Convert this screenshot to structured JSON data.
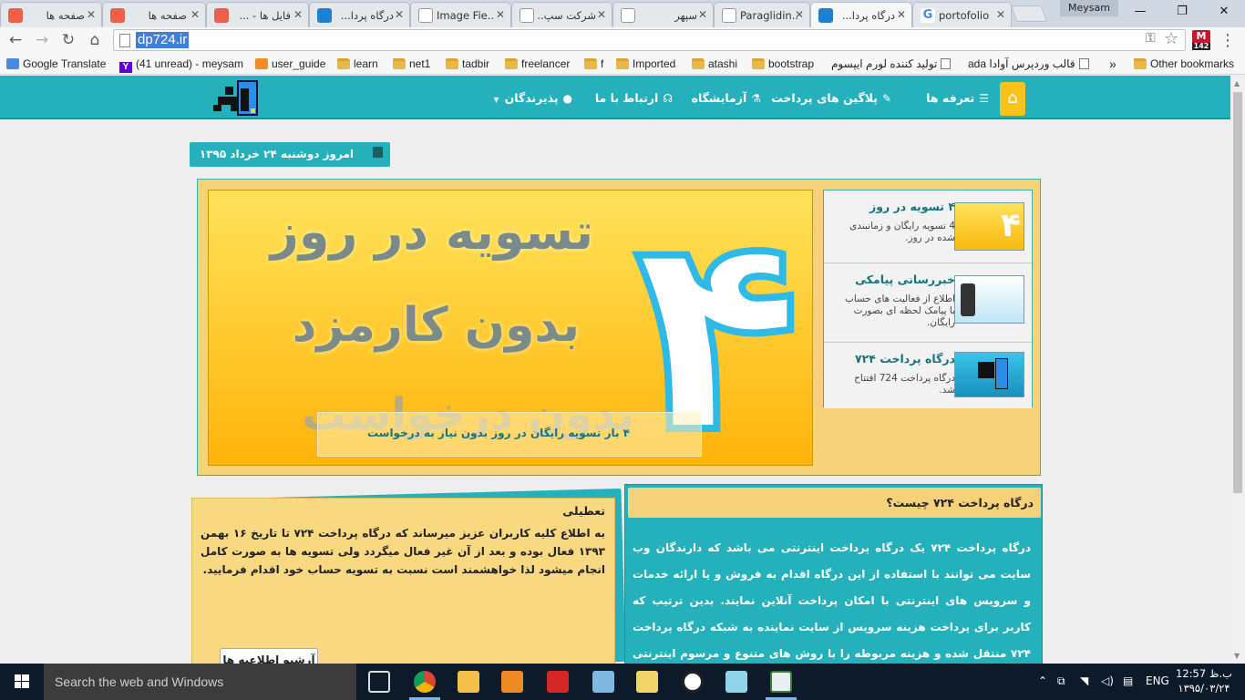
{
  "browser": {
    "tabs": [
      {
        "title": "صفحه ها",
        "favicon_color": "#e9614b"
      },
      {
        "title": "صفحه ها",
        "favicon_color": "#e9614b"
      },
      {
        "title": "فایل ها - ...",
        "favicon_color": "#e9614b"
      },
      {
        "title": "درگاه پردا...",
        "favicon_color": "#1e80d0"
      },
      {
        "title": "Image Fie...",
        "favicon_color": "#ffffff"
      },
      {
        "title": "شرکت سپ...",
        "favicon_color": "#ffffff"
      },
      {
        "title": "سپهر",
        "favicon_color": "#ffffff"
      },
      {
        "title": "Paraglidin...",
        "favicon_color": "#ffffff"
      },
      {
        "title": "درگاه پردا...",
        "favicon_color": "#1e80d0"
      },
      {
        "title": "portofolio",
        "favicon_color": "#4285f4"
      }
    ],
    "profile_name": "Meysam",
    "url": "dp724.ir",
    "extension_badge_top": "M",
    "extension_badge_bottom": "142",
    "bookmarks": [
      {
        "label": "Google Translate",
        "icon": "translate-icon"
      },
      {
        "label": "(41 unread) - meysam",
        "icon": "yahoo-icon"
      },
      {
        "label": "user_guide",
        "icon": "orange-grid-icon"
      },
      {
        "label": "learn",
        "icon": "folder-icon"
      },
      {
        "label": "net1",
        "icon": "folder-icon"
      },
      {
        "label": "tadbir",
        "icon": "folder-icon"
      },
      {
        "label": "freelancer",
        "icon": "folder-icon"
      },
      {
        "label": "f",
        "icon": "folder-icon"
      },
      {
        "label": "Imported",
        "icon": "folder-icon"
      },
      {
        "label": "atashi",
        "icon": "folder-icon"
      },
      {
        "label": "bootstrap",
        "icon": "folder-icon"
      },
      {
        "label": "تولید کننده لورم ایپسوم",
        "icon": "page-icon"
      },
      {
        "label": "قالب وردپرس آوادا ada",
        "icon": "page-icon"
      }
    ],
    "bookmarks_overflow": "»",
    "other_bookmarks": "Other bookmarks"
  },
  "site": {
    "colors": {
      "teal": "#25b1bc",
      "yellow": "#f9c31c",
      "cream": "#f5d27a"
    },
    "menu": [
      {
        "label": "تعرفه ها",
        "icon": "list-icon"
      },
      {
        "label": "پلاگین های پرداخت",
        "icon": "wrench-icon"
      },
      {
        "label": "آزمایشگاه",
        "icon": "flask-icon"
      },
      {
        "label": "ارتباط با ما",
        "icon": "headphones-icon"
      },
      {
        "label": "پذیرندگان",
        "icon": "user-icon"
      }
    ],
    "date_text": "امروز دوشنبه ۲۴ خرداد ۱۳۹۵",
    "banner": {
      "line1": "تسویه در روز",
      "line2": "بدون کارمزد",
      "line3": "بدون درخواست",
      "big_number": "۴",
      "caption": "۴ بار تسویه رایگان در روز بدون نیاز به درخواست"
    },
    "side_items": [
      {
        "title": "۴ تسویه در روز",
        "desc": "4 تسویه رایگان و زمانبندی شده در روز."
      },
      {
        "title": "خبررسانی پیامکی",
        "desc": "اطلاع از فعالیت های حساب با پیامک لحظه ای بصورت رایگان."
      },
      {
        "title": "درگاه پرداخت ۷۲۴",
        "desc": "درگاه پرداخت 724 افتتاح شد."
      }
    ],
    "notice": {
      "title": "تعطیلی",
      "body": "به اطلاع کلیه کاربران عزیز میرساند که درگاه پرداخت ۷۲۴ تا تاریخ ۱۶ بهمن ۱۳۹۳ فعال بوده و بعد از آن غیر فعال میگردد ولی تسویه ها به صورت کامل انجام میشود لذا خواهشمند است نسبت به تسویه حساب خود اقدام فرمایید.",
      "archive_button": "آرشیو اطلاعیه ها"
    },
    "what_is": {
      "title": "درگاه پرداخت ۷۲۴ چیست؟",
      "body": "درگاه پرداخت ۷۲۴ یک درگاه پرداخت اینترنتی می باشد که دارندگان وب سایت می توانند با استفاده از این درگاه اقدام به فروش و یا ارائه خدمات و سرویس های اینترنتی با امکان پرداخت آنلاین نمایند. بدین ترتیب که کاربر برای پرداخت هزینه سرویس از سایت نماینده به شبکه درگاه پرداخت ۷۲۴ منتقل شده و هزینه مربوطه را با روش های متنوع و مرسوم اینترنتی پرداخت می نماید و مجددا برای ادامه"
    }
  },
  "taskbar": {
    "search_placeholder": "Search the web and Windows",
    "language": "ENG",
    "time": "12:57 ب.ظ",
    "date": "۱۳۹۵/۰۳/۲۴"
  }
}
